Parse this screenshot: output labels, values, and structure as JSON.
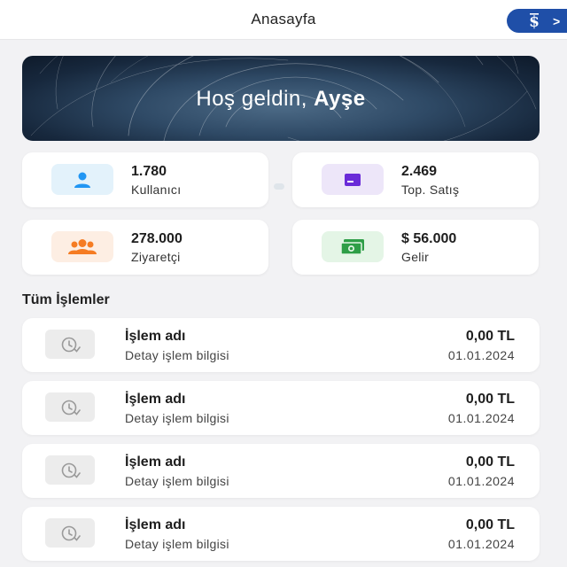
{
  "header": {
    "title": "Anasayfa",
    "brand_chevron": ">"
  },
  "hero": {
    "greeting": "Hoş geldin, ",
    "name": "Ayşe"
  },
  "stats": [
    {
      "value": "1.780",
      "label": "Kullanıcı",
      "icon": "user-icon",
      "icon_bg": "#e3f2fb",
      "icon_color": "#2196f3"
    },
    {
      "value": "2.469",
      "label": "Top. Satış",
      "icon": "card-icon",
      "icon_bg": "#ede6f9",
      "icon_color": "#6a2bd8"
    },
    {
      "value": "278.000",
      "label": "Ziyaretçi",
      "icon": "group-icon",
      "icon_bg": "#fdeee3",
      "icon_color": "#f57c23"
    },
    {
      "value": "$ 56.000",
      "label": "Gelir",
      "icon": "money-icon",
      "icon_bg": "#e4f5e6",
      "icon_color": "#2e9e47"
    }
  ],
  "transactions_title": "Tüm İşlemler",
  "transactions": [
    {
      "name": "İşlem adı",
      "detail": "Detay işlem bilgisi",
      "amount": "0,00 TL",
      "date": "01.01.2024"
    },
    {
      "name": "İşlem adı",
      "detail": "Detay işlem bilgisi",
      "amount": "0,00 TL",
      "date": "01.01.2024"
    },
    {
      "name": "İşlem adı",
      "detail": "Detay işlem bilgisi",
      "amount": "0,00 TL",
      "date": "01.01.2024"
    },
    {
      "name": "İşlem adı",
      "detail": "Detay işlem bilgisi",
      "amount": "0,00 TL",
      "date": "01.01.2024"
    }
  ],
  "colors": {
    "brand": "#1f4fa8",
    "background": "#f2f2f4",
    "card": "#ffffff"
  }
}
